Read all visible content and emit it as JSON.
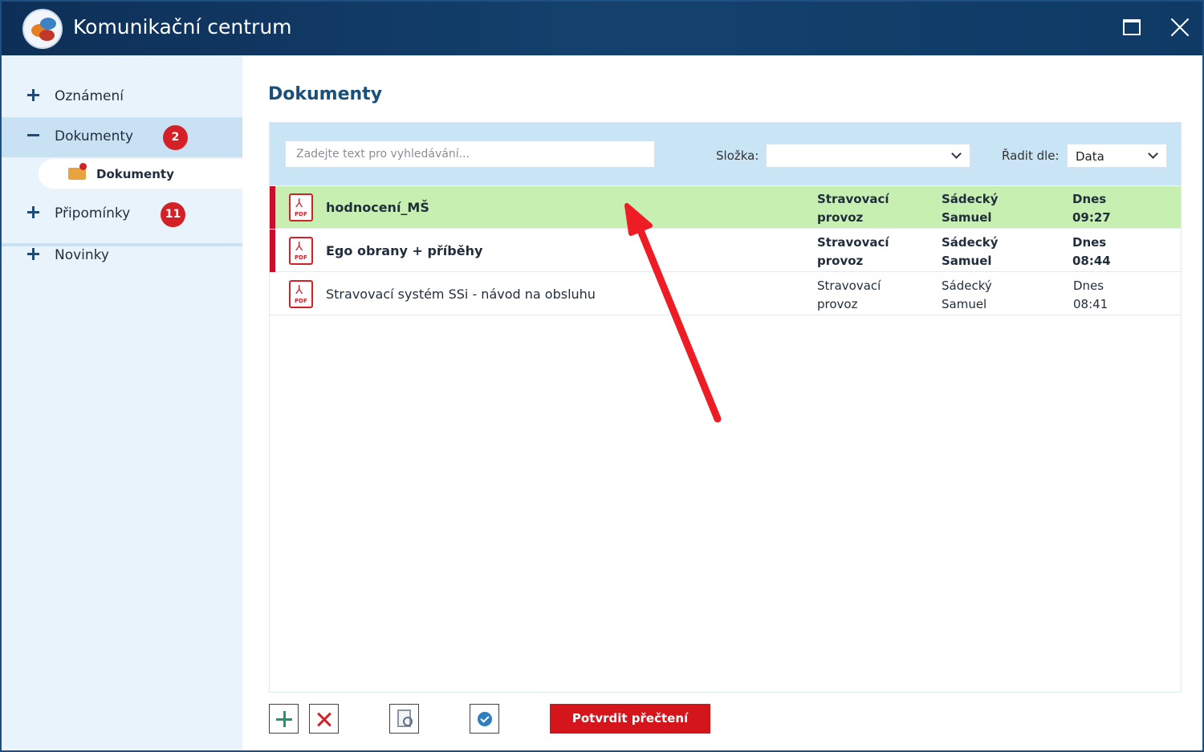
{
  "window": {
    "title": "Komunikační centrum",
    "maximize_icon": "maximize-icon",
    "close_icon": "close-icon"
  },
  "sidebar": {
    "items": [
      {
        "label": "Oznámení",
        "sign": "plus"
      },
      {
        "label": "Dokumenty",
        "sign": "minus",
        "badge": "2",
        "active": true
      },
      {
        "label": "Připomínky",
        "sign": "plus",
        "badge": "11"
      },
      {
        "label": "Novinky",
        "sign": "plus"
      }
    ],
    "subitem": {
      "label": "Dokumenty",
      "icon": "envelope-icon"
    }
  },
  "main": {
    "title": "Dokumenty",
    "search": {
      "placeholder": "Zadejte text pro vyhledávání...",
      "value": ""
    },
    "folder": {
      "label": "Složka:",
      "value": ""
    },
    "sort": {
      "label": "Řadit dle:",
      "value": "Data"
    }
  },
  "documents": [
    {
      "name": "hodnocení_MŠ",
      "folder_l1": "Stravovací",
      "folder_l2": "provoz",
      "author_l1": "Sádecký",
      "author_l2": "Samuel",
      "date_l1": "Dnes",
      "date_l2": "09:27",
      "unread": true,
      "selected": true,
      "icon": "pdf-icon"
    },
    {
      "name": "Ego obrany + příběhy",
      "folder_l1": "Stravovací",
      "folder_l2": "provoz",
      "author_l1": "Sádecký",
      "author_l2": "Samuel",
      "date_l1": "Dnes",
      "date_l2": "08:44",
      "unread": true,
      "selected": false,
      "icon": "pdf-icon"
    },
    {
      "name": "Stravovací systém SSi - návod na obsluhu",
      "folder_l1": "Stravovací",
      "folder_l2": "provoz",
      "author_l1": "Sádecký",
      "author_l2": "Samuel",
      "date_l1": "Dnes",
      "date_l2": "08:41",
      "unread": false,
      "selected": false,
      "icon": "pdf-icon"
    }
  ],
  "pdf_icon_text": "PDF",
  "toolbar": {
    "confirm_label": "Potvrdit přečtení"
  },
  "colors": {
    "titlebar": "#0f3a66",
    "accent_red": "#d4161c",
    "selected_row": "#c8efb2",
    "filter_bg": "#c9e4f4",
    "sidebar_bg": "#e8f3fb"
  }
}
